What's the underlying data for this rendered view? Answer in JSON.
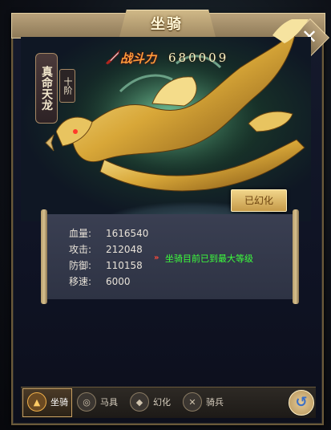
{
  "window": {
    "title": "坐骑",
    "close_icon": "close-icon"
  },
  "mount": {
    "name": "真命天龙",
    "rank": "十阶",
    "power_label": "战斗力",
    "power_value": "680009",
    "transform_button": "已幻化"
  },
  "stats": [
    {
      "label": "血量:",
      "value": "1616540"
    },
    {
      "label": "攻击:",
      "value": "212048"
    },
    {
      "label": "防御:",
      "value": "110158"
    },
    {
      "label": "移速:",
      "value": "6000"
    }
  ],
  "max_level_message": "坐骑目前已到最大等级",
  "tabs": [
    {
      "label": "坐骑",
      "icon": "mount-icon",
      "active": true
    },
    {
      "label": "马具",
      "icon": "saddle-icon",
      "active": false
    },
    {
      "label": "幻化",
      "icon": "transform-icon",
      "active": false
    },
    {
      "label": "骑兵",
      "icon": "cavalry-icon",
      "active": false
    }
  ],
  "colors": {
    "accent": "#c9a163",
    "highlight_text": "#3cff3c",
    "power": "#ff9a3a"
  }
}
